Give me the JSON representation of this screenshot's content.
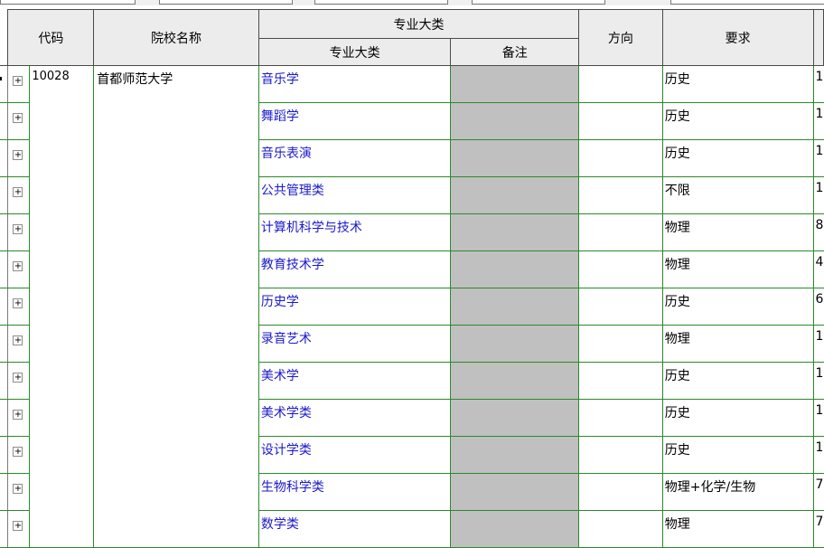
{
  "header": {
    "code": "代码",
    "school": "院校名称",
    "major_group": "专业大类",
    "major": "专业大类",
    "note": "备注",
    "direction": "方向",
    "requirement": "要求"
  },
  "expander_symbol": "+",
  "school": {
    "code": "10028",
    "name": "首都师范大学"
  },
  "rows": [
    {
      "major": "音乐学",
      "note": "",
      "direction": "",
      "requirement": "历史",
      "extra": "1"
    },
    {
      "major": "舞蹈学",
      "note": "",
      "direction": "",
      "requirement": "历史",
      "extra": "1"
    },
    {
      "major": "音乐表演",
      "note": "",
      "direction": "",
      "requirement": "历史",
      "extra": "1"
    },
    {
      "major": "公共管理类",
      "note": "",
      "direction": "",
      "requirement": "不限",
      "extra": "1"
    },
    {
      "major": "计算机科学与技术",
      "note": "",
      "direction": "",
      "requirement": "物理",
      "extra": "8"
    },
    {
      "major": "教育技术学",
      "note": "",
      "direction": "",
      "requirement": "物理",
      "extra": "4"
    },
    {
      "major": "历史学",
      "note": "",
      "direction": "",
      "requirement": "历史",
      "extra": "6"
    },
    {
      "major": "录音艺术",
      "note": "",
      "direction": "",
      "requirement": "物理",
      "extra": "1"
    },
    {
      "major": "美术学",
      "note": "",
      "direction": "",
      "requirement": "历史",
      "extra": "1"
    },
    {
      "major": "美术学类",
      "note": "",
      "direction": "",
      "requirement": "历史",
      "extra": "1"
    },
    {
      "major": "设计学类",
      "note": "",
      "direction": "",
      "requirement": "历史",
      "extra": "1"
    },
    {
      "major": "生物科学类",
      "note": "",
      "direction": "",
      "requirement": "物理+化学/生物",
      "extra": "7"
    },
    {
      "major": "数学类",
      "note": "",
      "direction": "",
      "requirement": "物理",
      "extra": "7"
    }
  ]
}
